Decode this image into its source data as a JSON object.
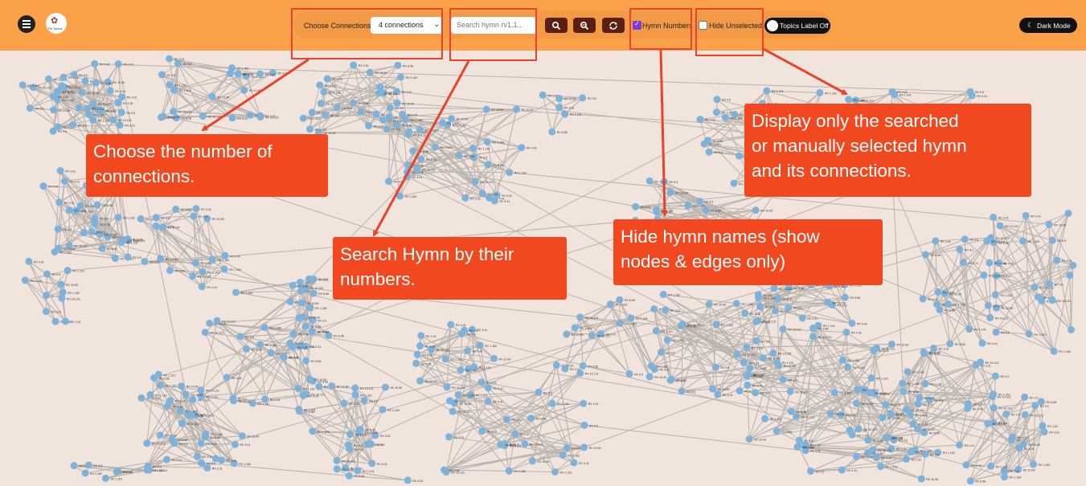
{
  "app": {
    "logo_label": "RV Netviz"
  },
  "toolbar": {
    "choose_label": "Choose Connections:",
    "connections_value": "4 connections",
    "search_placeholder": "Search hymn rv1.1...",
    "buttons": [
      "zoom-in-search",
      "zoom-out-search",
      "refresh"
    ],
    "hymn_numbers_label": "Hymn Numbers",
    "hymn_numbers_checked": true,
    "hide_unselected_label": "Hide Unselected",
    "hide_unselected_checked": false,
    "topics_label": "Topics Label Off",
    "dark_mode_label": "Dark Mode"
  },
  "colors": {
    "header": "#fba14a",
    "node": "#7fb2d9",
    "edge": "#b9b3ae",
    "callout": "#f1481f",
    "background": "#f1e4dd"
  },
  "callouts": {
    "connections": [
      "Choose the number of",
      "connections."
    ],
    "search": [
      "Search Hymn by their",
      "numbers."
    ],
    "hide_names": [
      "Hide hymn names (show",
      "nodes & edges only)"
    ],
    "display_only": [
      "Display only the searched",
      "or manually selected hymn",
      "and its connections."
    ]
  },
  "graph": {
    "node_label_examples": [
      "RV 10.121",
      "RV 1.101",
      "RV 9.5",
      "RV 3.31",
      "RV 1.162",
      "RV 10.90",
      "RV 8.56",
      "RV 4.41"
    ]
  }
}
